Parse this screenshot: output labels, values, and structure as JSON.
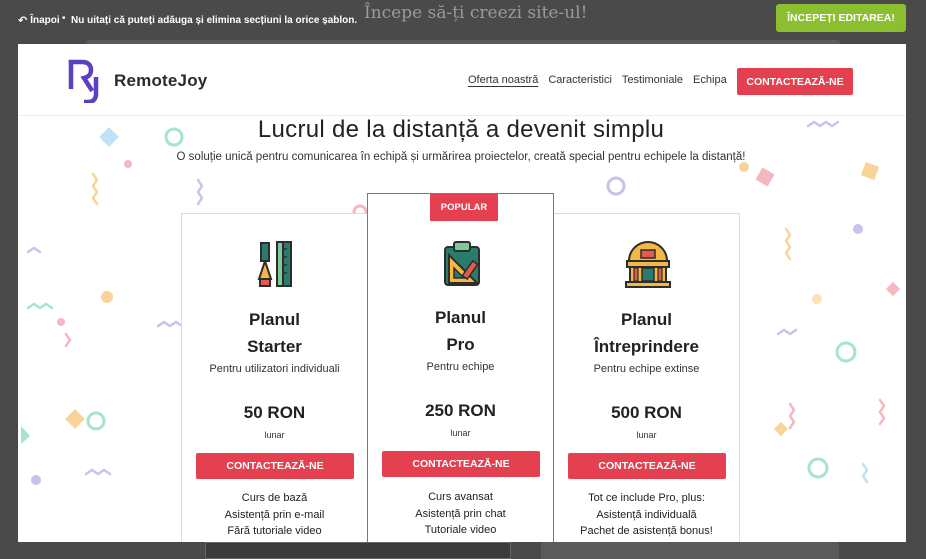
{
  "editor": {
    "back_label": "Înapoi",
    "bullet": "•",
    "hint": "Nu uitați că puteți adăuga și elimina secțiuni la orice șablon.",
    "background_title": "Începe să-ți creezi site-ul!",
    "start_button": "ÎNCEPEȚI EDITAREA!"
  },
  "site": {
    "brand": "RemoteJoy",
    "nav": [
      "Oferta noastră",
      "Caracteristici",
      "Testimoniale",
      "Echipa"
    ],
    "nav_cta": "CONTACTEAZĂ-NE",
    "hero_title": "Lucrul de la distanță a devenit simplu",
    "hero_subtitle": "O soluție unică pentru comunicarea în echipă și urmărirea proiectelor, creată special pentru echipele la distanță!"
  },
  "plans": {
    "starter": {
      "icon": "pen-ruler-icon",
      "title_line1": "Planul",
      "title_line2": "Starter",
      "subtitle": "Pentru utilizatori individuali",
      "price": "50 RON",
      "period": "lunar",
      "button": "CONTACTEAZĂ-NE",
      "features": [
        "Curs de bază",
        "Asistență prin e-mail",
        "Fără tutoriale video"
      ]
    },
    "pro": {
      "badge": "POPULAR",
      "icon": "clipboard-ruler-icon",
      "title_line1": "Planul",
      "title_line2": "Pro",
      "subtitle": "Pentru echipe",
      "price": "250 RON",
      "period": "lunar",
      "button": "CONTACTEAZĂ-NE",
      "features": [
        "Curs avansat",
        "Asistență prin chat",
        "Tutoriale video"
      ]
    },
    "enterprise": {
      "icon": "building-icon",
      "title_line1": "Planul",
      "title_line2": "Întreprindere",
      "subtitle": "Pentru echipe extinse",
      "price": "500 RON",
      "period": "lunar",
      "button": "CONTACTEAZĂ-NE",
      "features": [
        "Tot ce include Pro, plus:",
        "Asistență individuală",
        "Pachet de asistență bonus!"
      ]
    }
  },
  "colors": {
    "accent": "#e5404f",
    "start_button": "#8bbf2f",
    "logo": "#5b3fc4"
  }
}
